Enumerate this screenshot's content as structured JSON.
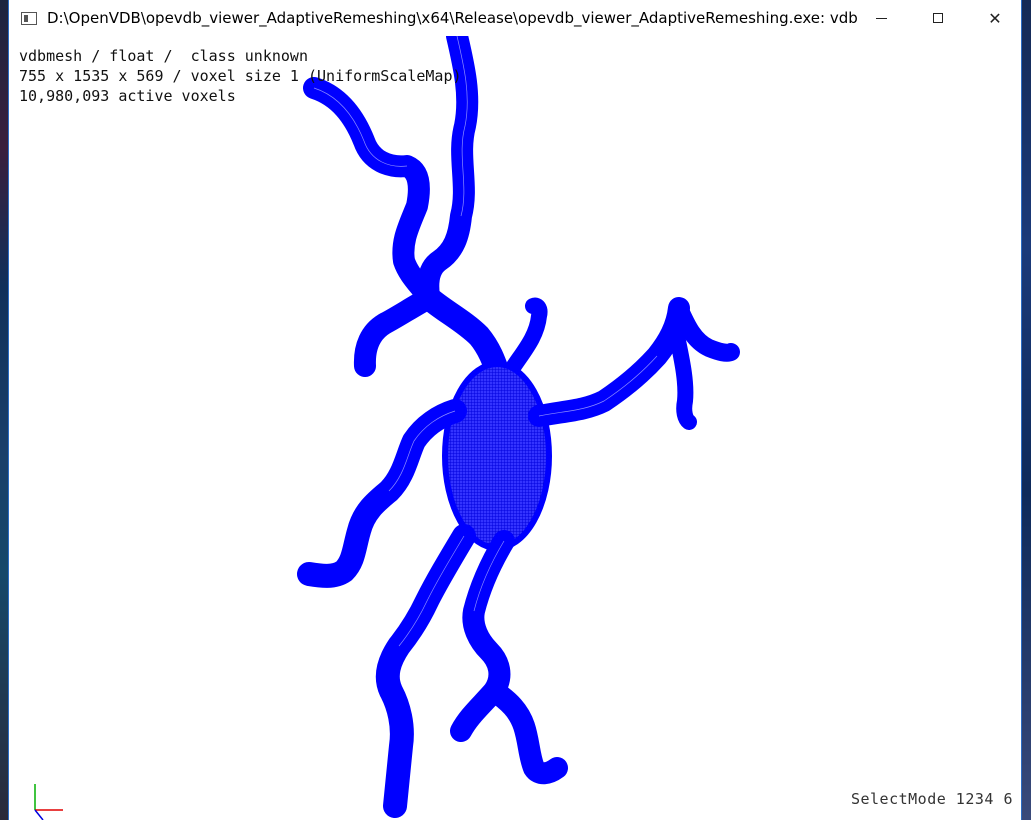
{
  "window": {
    "title": "D:\\OpenVDB\\opevdb_viewer_AdaptiveRemeshing\\x64\\Release\\opevdb_viewer_AdaptiveRemeshing.exe: vdb...",
    "minimize_symbol": "",
    "close_symbol": "✕"
  },
  "hud": {
    "line1": "vdbmesh / float /  class unknown",
    "line2": "755 x 1535 x 569 / voxel size 1 (UniformScaleMap)",
    "line3": "10,980,093 active voxels"
  },
  "status": {
    "mode": "SelectMode 1234 6"
  },
  "colors": {
    "mesh": "#0000ff",
    "axis_x": "#e00000",
    "axis_y": "#00b000",
    "axis_z": "#0000e0"
  },
  "icons": [
    "app-icon",
    "minimize-icon",
    "maximize-icon",
    "close-icon",
    "axis-gizmo-icon"
  ]
}
